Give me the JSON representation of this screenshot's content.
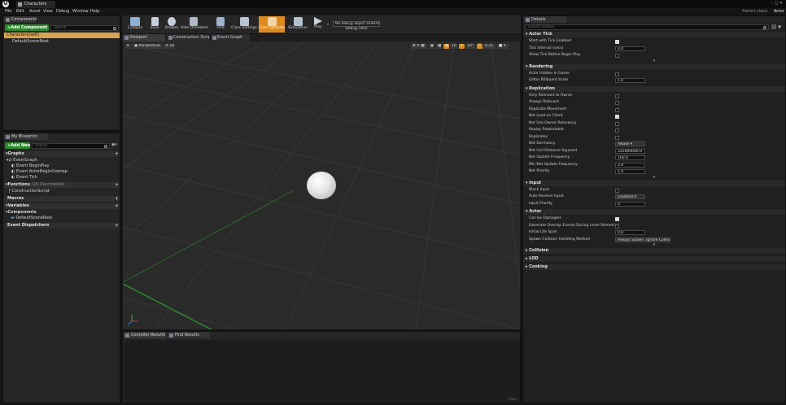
{
  "window": {
    "app_logo": "U",
    "tab_title": "Characters",
    "controls": "–  □  ✕"
  },
  "menu": [
    "File",
    "Edit",
    "Asset",
    "View",
    "Debug",
    "Window",
    "Help"
  ],
  "parent_class": {
    "label": "Parent class:",
    "value": "Actor"
  },
  "components": {
    "tab": "Components",
    "add_button": "+Add Component ▾",
    "search_placeholder": "Search",
    "items": [
      "Characters(self)",
      "DefaultSceneRoot"
    ]
  },
  "my_blueprint": {
    "tab": "My Blueprint",
    "add_button": "+Add New ▾",
    "search_placeholder": "Search",
    "sections": {
      "graphs": "Graphs",
      "event_graph": "EventGraph",
      "events": [
        "Event BeginPlay",
        "Event ActorBeginOverlap",
        "Event Tick"
      ],
      "functions": "Functions",
      "functions_count": "(16 Overridable)",
      "construction_script": "ConstructionScript",
      "macros": "Macros",
      "variables": "Variables",
      "components_cat": "Components",
      "default_scene_root": "DefaultSceneRoot",
      "event_dispatchers": "Event Dispatchers"
    }
  },
  "toolbar": {
    "buttons": [
      "Compile",
      "Save",
      "Browse",
      "Hide Unrelated",
      "Find",
      "Class Settings",
      "Class Defaults",
      "Simulation",
      "Play"
    ],
    "debug_select": "No debug object selected ▾",
    "debug_filter": "Debug Filter"
  },
  "editor_tabs": [
    "Viewport",
    "Construction Script",
    "Event Graph"
  ],
  "viewport": {
    "perspective": "Perspective",
    "lit": "Lit",
    "grid_snap": "10",
    "rot_snap": "10°",
    "scale_snap": "0.25",
    "cam_speed": "4"
  },
  "compiler": {
    "tabs": [
      "Compiler Results",
      "Find Results"
    ],
    "clear": "Clear"
  },
  "details": {
    "tab": "Details",
    "search_placeholder": "Search Details",
    "sections": [
      {
        "title": "Actor Tick",
        "rows": [
          {
            "label": "Start with Tick Enabled",
            "kind": "check",
            "on": true
          },
          {
            "label": "Tick Interval (secs)",
            "kind": "num",
            "value": "0.0"
          },
          {
            "label": "Allow Tick Before Begin Play",
            "kind": "check",
            "on": false
          }
        ],
        "more": true
      },
      {
        "title": "Rendering",
        "rows": [
          {
            "label": "Actor Hidden In Game",
            "kind": "check",
            "on": false
          },
          {
            "label": "Editor Billboard Scale",
            "kind": "num",
            "value": "1.0"
          }
        ],
        "more": false
      },
      {
        "title": "Replication",
        "rows": [
          {
            "label": "Only Relevant to Owner",
            "kind": "check",
            "on": false
          },
          {
            "label": "Always Relevant",
            "kind": "check",
            "on": false
          },
          {
            "label": "Replicate Movement",
            "kind": "check",
            "on": false
          },
          {
            "label": "Net Load on Client",
            "kind": "check",
            "on": true
          },
          {
            "label": "Net Use Owner Relevancy",
            "kind": "check",
            "on": false
          },
          {
            "label": "Replay Rewindable",
            "kind": "check",
            "on": false
          },
          {
            "label": "Replicates",
            "kind": "check",
            "on": false
          },
          {
            "label": "Net Dormancy",
            "kind": "combo",
            "value": "Awake ▾"
          },
          {
            "label": "Net Cull Distance Squared",
            "kind": "num",
            "value": "225000000.0"
          },
          {
            "label": "Net Update Frequency",
            "kind": "num",
            "value": "100.0"
          },
          {
            "label": "Min Net Update Frequency",
            "kind": "num",
            "value": "2.0"
          },
          {
            "label": "Net Priority",
            "kind": "num",
            "value": "1.0"
          }
        ],
        "more": true
      },
      {
        "title": "Input",
        "rows": [
          {
            "label": "Block Input",
            "kind": "check",
            "on": false
          },
          {
            "label": "Auto Receive Input",
            "kind": "combo",
            "value": "Disabled ▾"
          },
          {
            "label": "Input Priority",
            "kind": "num",
            "value": "0"
          }
        ],
        "more": false
      },
      {
        "title": "Actor",
        "rows": [
          {
            "label": "Can be Damaged",
            "kind": "check",
            "on": true
          },
          {
            "label": "Generate Overlap Events During Level Streaming",
            "kind": "check",
            "on": false
          },
          {
            "label": "Initial Life Span",
            "kind": "num",
            "value": "0.0"
          },
          {
            "label": "Spawn Collision Handling Method",
            "kind": "combo",
            "value": "Always Spawn, Ignore Collisions ▾"
          }
        ],
        "more": true
      },
      {
        "title": "Collision",
        "rows": [],
        "more": false,
        "collapsed": true
      },
      {
        "title": "LOD",
        "rows": [],
        "more": false,
        "collapsed": true
      },
      {
        "title": "Cooking",
        "rows": [],
        "more": false,
        "collapsed": true
      }
    ]
  }
}
